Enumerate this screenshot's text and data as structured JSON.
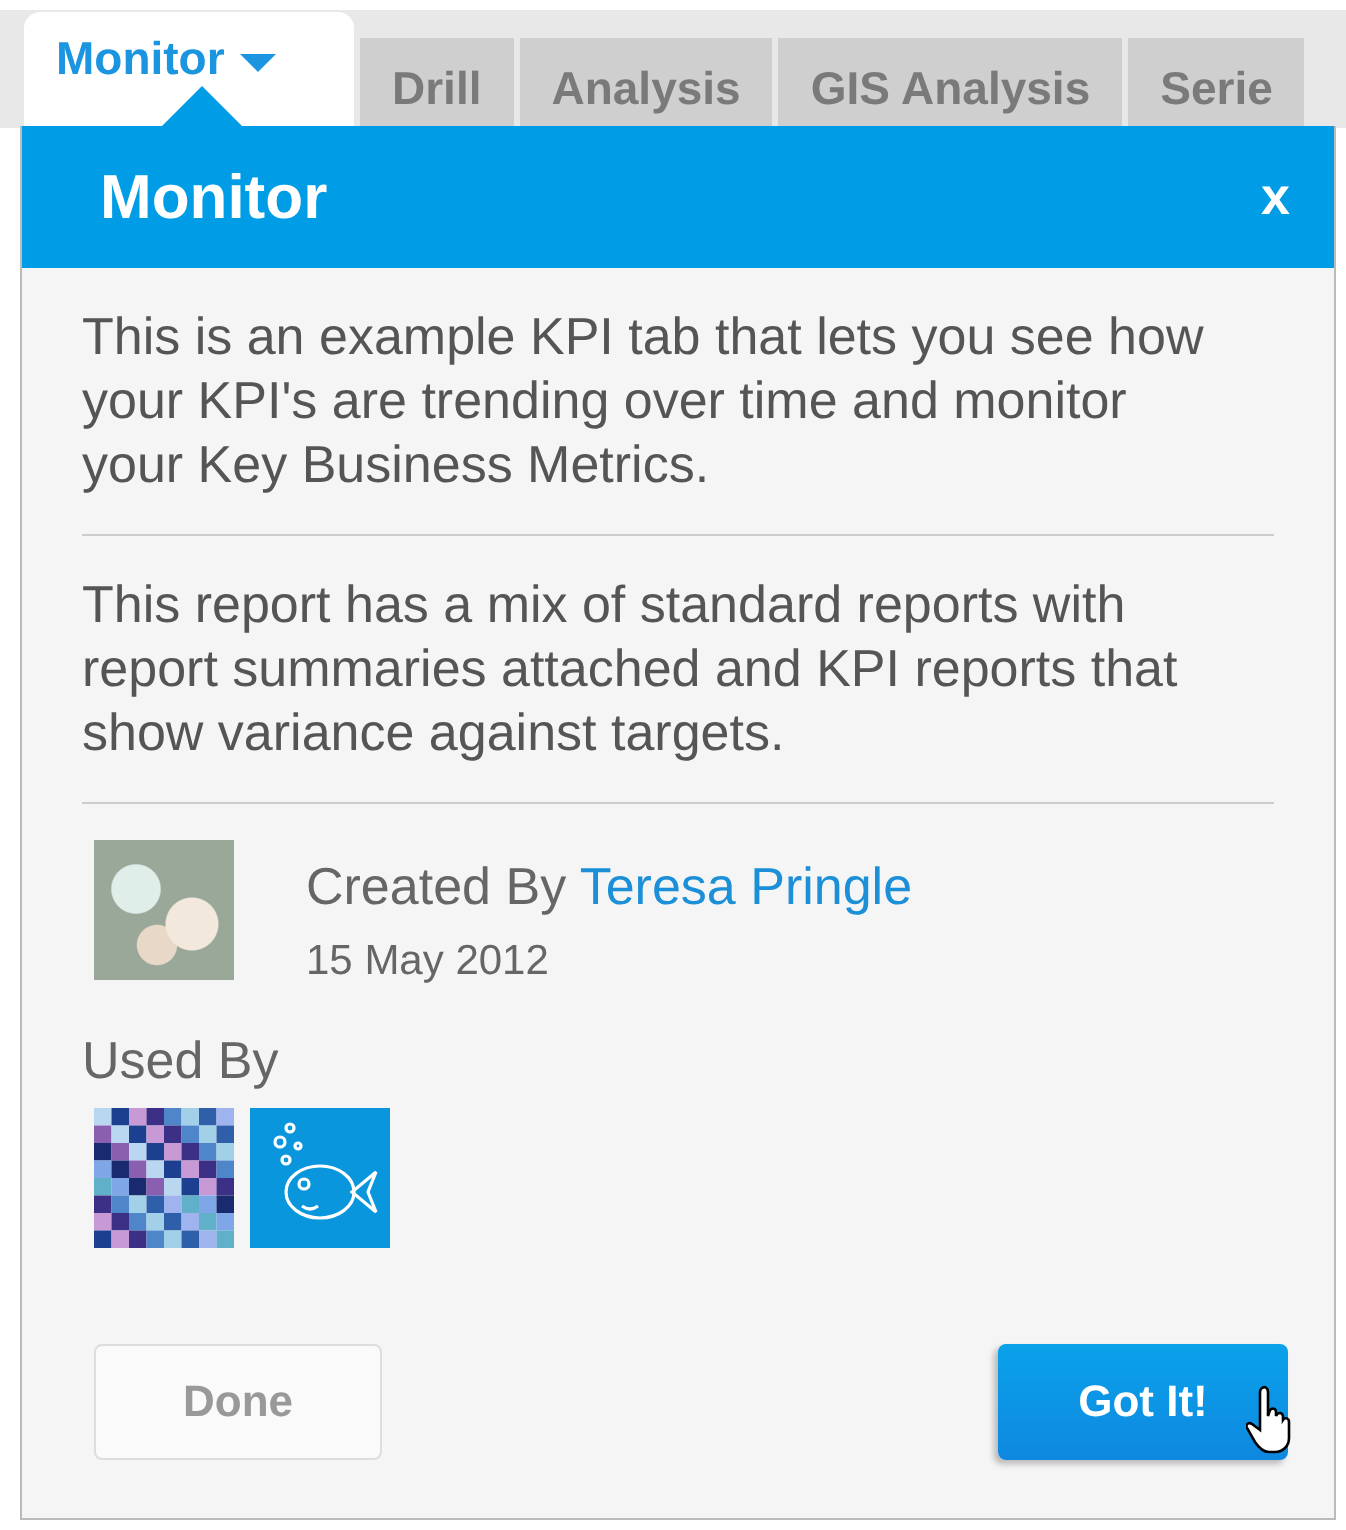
{
  "tabs": [
    {
      "label": "Monitor",
      "selected": true,
      "dropdown": true
    },
    {
      "label": "Drill",
      "selected": false,
      "dropdown": false
    },
    {
      "label": "Analysis",
      "selected": false,
      "dropdown": false
    },
    {
      "label": "GIS Analysis",
      "selected": false,
      "dropdown": false
    },
    {
      "label": "Serie",
      "selected": false,
      "dropdown": false
    }
  ],
  "popup": {
    "title": "Monitor",
    "close": "x",
    "paragraphs": [
      "This is an example KPI tab that lets you see how your KPI's are trending over time and monitor your Key Business Metrics.",
      "This report has a mix of standard reports with report summaries attached and KPI reports that show variance against targets."
    ],
    "created": {
      "label": "Created By",
      "author": "Teresa Pringle",
      "date": "15 May 2012"
    },
    "used_by": {
      "label": "Used By"
    },
    "buttons": [
      {
        "label": "Done",
        "kind": "secondary"
      },
      {
        "label": "Got It!",
        "kind": "primary"
      }
    ]
  }
}
